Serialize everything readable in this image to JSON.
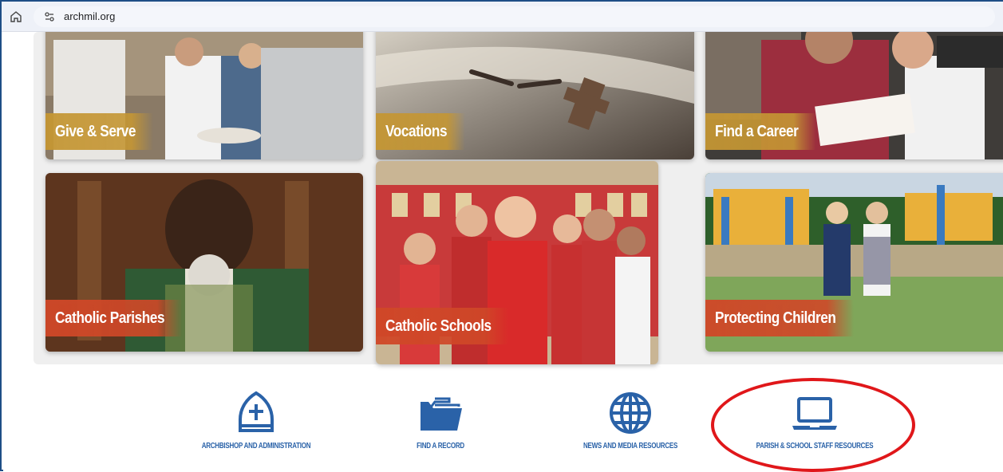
{
  "browser": {
    "url": "archmil.org"
  },
  "tiles": [
    {
      "id": "give-serve",
      "label": "Give & Serve",
      "label_style": "gold"
    },
    {
      "id": "vocations",
      "label": "Vocations",
      "label_style": "gold"
    },
    {
      "id": "find-career",
      "label": "Find a Career",
      "label_style": "gold"
    },
    {
      "id": "catholic-parishes",
      "label": "Catholic Parishes",
      "label_style": "red"
    },
    {
      "id": "catholic-schools",
      "label": "Catholic Schools",
      "label_style": "red"
    },
    {
      "id": "protecting-children",
      "label": "Protecting Children",
      "label_style": "red"
    }
  ],
  "quick_links": [
    {
      "label": "ARCHBISHOP AND ADMINISTRATION",
      "icon": "mitre-cross-icon"
    },
    {
      "label": "FIND A RECORD",
      "icon": "folder-icon"
    },
    {
      "label": "NEWS AND MEDIA RESOURCES",
      "icon": "globe-icon"
    },
    {
      "label": "PARISH & SCHOOL STAFF RESOURCES",
      "icon": "laptop-icon"
    }
  ],
  "colors": {
    "link_blue": "#2a62a8",
    "label_gold": "#c49634",
    "label_red": "#cf4828",
    "annotation_red": "#e0171a"
  }
}
